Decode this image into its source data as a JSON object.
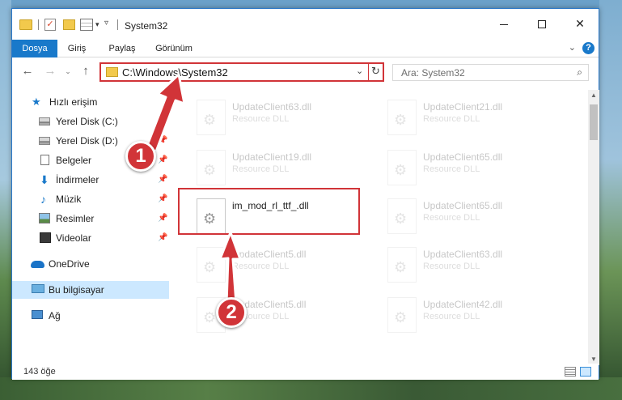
{
  "window": {
    "title": "System32"
  },
  "ribbon": {
    "tabs": [
      "Dosya",
      "Giriş",
      "Paylaş",
      "Görünüm"
    ],
    "help_label": "?"
  },
  "navigation": {
    "address": "C:\\Windows\\System32",
    "search_placeholder": "Ara: System32"
  },
  "sidebar": {
    "items": [
      {
        "label": "Hızlı erişim",
        "icon": "star-icon"
      },
      {
        "label": "Yerel Disk (C:)",
        "icon": "drive-icon"
      },
      {
        "label": "Yerel Disk (D:)",
        "icon": "drive-icon"
      },
      {
        "label": "Belgeler",
        "icon": "documents-icon"
      },
      {
        "label": "İndirmeler",
        "icon": "download-icon"
      },
      {
        "label": "Müzik",
        "icon": "music-icon"
      },
      {
        "label": "Resimler",
        "icon": "pictures-icon"
      },
      {
        "label": "Videolar",
        "icon": "video-icon"
      },
      {
        "label": "OneDrive",
        "icon": "cloud-icon"
      },
      {
        "label": "Bu bilgisayar",
        "icon": "computer-icon"
      },
      {
        "label": "Ağ",
        "icon": "network-icon"
      }
    ],
    "selected": "Bu bilgisayar"
  },
  "files": [
    {
      "name": "UpdateClient63.dll",
      "type": "Resource DLL"
    },
    {
      "name": "UpdateClient21.dll",
      "type": "Resource DLL"
    },
    {
      "name": "UpdateClient19.dll",
      "type": "Resource DLL"
    },
    {
      "name": "UpdateClient65.dll",
      "type": "Resource DLL"
    },
    {
      "name": "im_mod_rl_ttf_.dll",
      "type": ""
    },
    {
      "name": "UpdateClient65.dll",
      "type": "Resource DLL"
    },
    {
      "name": "UpdateClient5.dll",
      "type": "Resource DLL"
    },
    {
      "name": "UpdateClient63.dll",
      "type": "Resource DLL"
    },
    {
      "name": "UpdateClient5.dll",
      "type": "Resource DLL"
    },
    {
      "name": "UpdateClient42.dll",
      "type": "Resource DLL"
    }
  ],
  "status": {
    "count": "143 öğe"
  },
  "annotations": {
    "step1": "1",
    "step2": "2",
    "color": "#d13438"
  }
}
